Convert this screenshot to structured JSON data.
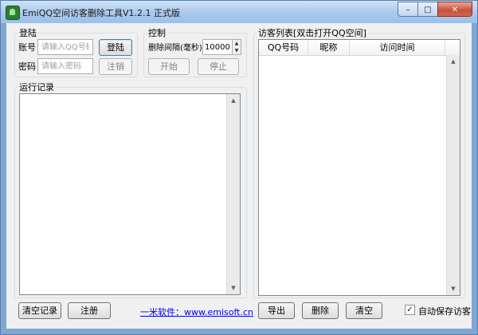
{
  "window": {
    "title": "EmiQQ空间访客删除工具V1.2.1 正式版",
    "min_glyph": "–",
    "max_glyph": "□",
    "close_glyph": "✕"
  },
  "login": {
    "group_label": "登陆",
    "account_label": "账号",
    "account_placeholder": "请输入QQ号码",
    "password_label": "密码",
    "password_placeholder": "请输入密码",
    "login_button": "登陆",
    "logout_button": "注销"
  },
  "control": {
    "group_label": "控制",
    "interval_label": "删除间隔(毫秒)",
    "interval_value": "10000",
    "start_button": "开始",
    "stop_button": "停止"
  },
  "log": {
    "group_label": "运行记录",
    "clear_button": "清空记录",
    "register_button": "注册",
    "site_link": "一米软件：www.emisoft.cn"
  },
  "visitors": {
    "group_label": "访客列表[双击打开QQ空间]",
    "columns": [
      "QQ号码",
      "昵称",
      "访问时间"
    ],
    "export_button": "导出",
    "delete_button": "删除",
    "clear_button": "清空",
    "autosave_label": "自动保存访客",
    "autosave_checked": true
  },
  "icons": {
    "scroll_up": "▲",
    "scroll_down": "▼",
    "spin_up": "▲",
    "spin_down": "▼",
    "check": "✓"
  }
}
